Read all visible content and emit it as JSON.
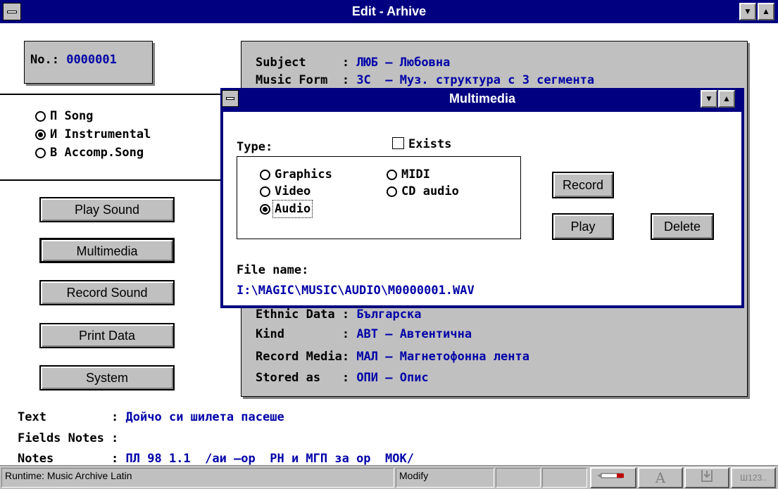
{
  "window": {
    "title": "Edit - Arhive",
    "minimize_glyph": "▼",
    "maximize_glyph": "▲"
  },
  "record": {
    "no_label": "No.:",
    "no_value": "0000001"
  },
  "song_type": {
    "options": [
      {
        "label": "П Song",
        "selected": false
      },
      {
        "label": "И Instrumental",
        "selected": true
      },
      {
        "label": "В Accomp.Song",
        "selected": false
      }
    ]
  },
  "buttons": {
    "play_sound": "Play Sound",
    "multimedia": "Multimedia",
    "record_sound": "Record Sound",
    "print_data": "Print Data",
    "system": "System"
  },
  "info_top": [
    {
      "label": "Subject     :",
      "value": "ЛЮБ – Любовна"
    },
    {
      "label": "Music Form  :",
      "value": "3C  – Муз. структура с 3 сегмента"
    }
  ],
  "info_bottom": [
    {
      "label": "Ethnic Data :",
      "value": "Българска"
    },
    {
      "label": "Kind        :",
      "value": "АВТ – Автентична"
    },
    {
      "label": "Record Media:",
      "value": "МАЛ – Магнетофонна лента"
    },
    {
      "label": "Stored as   :",
      "value": "ОПИ – Опис"
    }
  ],
  "bottom_fields": [
    {
      "label": "Text         :",
      "value": "Дойчо си шилета пасеше"
    },
    {
      "label": "Fields Notes :",
      "value": ""
    },
    {
      "label": "Notes        :",
      "value": "ПЛ 98 1.1  /аи –ор  РН и МГП за ор  МОК/"
    }
  ],
  "multimedia_dialog": {
    "title": "Multimedia",
    "type_label": "Type:",
    "exists_label": "Exists",
    "exists_checked": false,
    "media_types": [
      {
        "label": "Graphics",
        "selected": false
      },
      {
        "label": "Video",
        "selected": false
      },
      {
        "label": "Audio",
        "selected": true
      },
      {
        "label": "MIDI",
        "selected": false
      },
      {
        "label": "CD audio",
        "selected": false
      }
    ],
    "record_button": "Record",
    "play_button": "Play",
    "delete_button": "Delete",
    "file_name_label": "File name:",
    "file_name_value": "I:\\MAGIC\\MUSIC\\AUDIO\\M0000001.WAV"
  },
  "status_bar": {
    "runtime": "Runtime: Music Archive Latin",
    "mode": "Modify",
    "last_cell": "Ш123..",
    "icons": [
      "pen-icon",
      "font-icon",
      "download-icon"
    ]
  }
}
